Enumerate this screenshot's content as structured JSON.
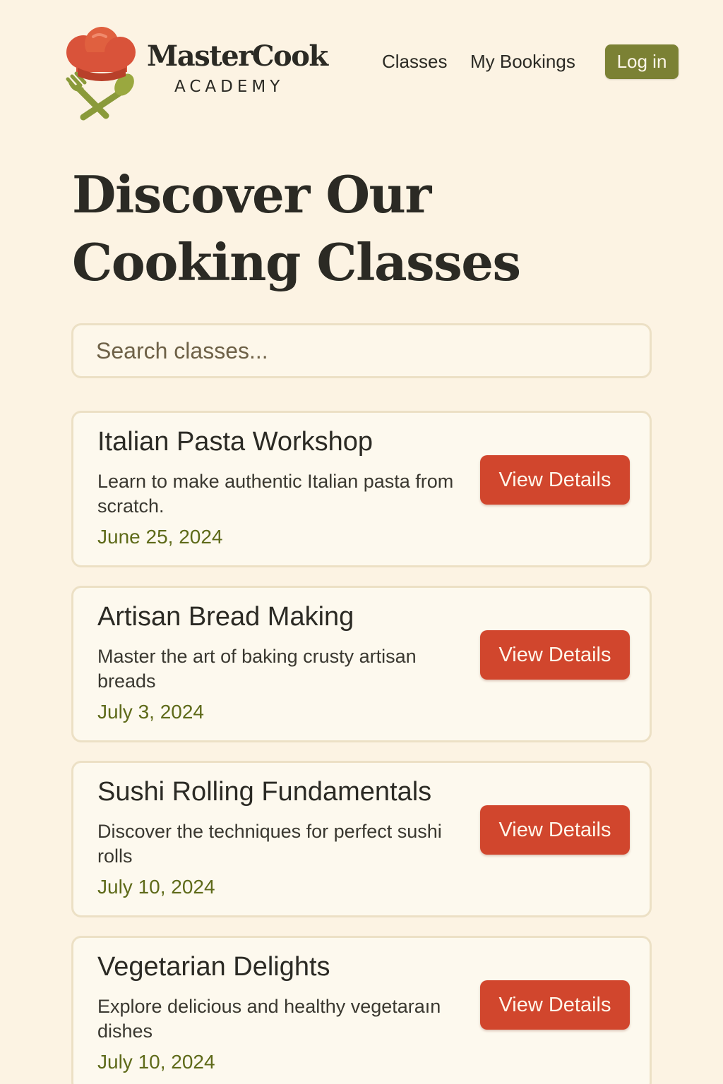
{
  "brand": {
    "name": "MasterCook",
    "subtitle": "ACADEMY"
  },
  "nav": {
    "classes": "Classes",
    "bookings": "My Bookings",
    "login": "Log in"
  },
  "page": {
    "title": "Discover Our Cooking Classes"
  },
  "search": {
    "placeholder": "Search classes..."
  },
  "classes": [
    {
      "title": "Italian Pasta Workshop",
      "description": "Learn to make authentic Italian pasta from scratch.",
      "date": "June 25, 2024",
      "button": "View Details"
    },
    {
      "title": "Artisan Bread Making",
      "description": "Master the art of baking crusty artisan breads",
      "date": "July 3, 2024",
      "button": "View Details"
    },
    {
      "title": "Sushi Rolling Fundamentals",
      "description": "Discover the techniques for perfect sushi rolls",
      "date": "July 10, 2024",
      "button": "View Details"
    },
    {
      "title": "Vegetarian Delights",
      "description": "Explore delicious and healthy vegetaraın dishes",
      "date": "July 10, 2024",
      "button": "View Details"
    }
  ],
  "colors": {
    "background": "#fcf3e3",
    "accent_red": "#d1462d",
    "accent_olive": "#7b8134",
    "date_green": "#5e6a19"
  },
  "icons": {
    "logo": "chef-hat-with-fork-and-spatula-icon"
  }
}
